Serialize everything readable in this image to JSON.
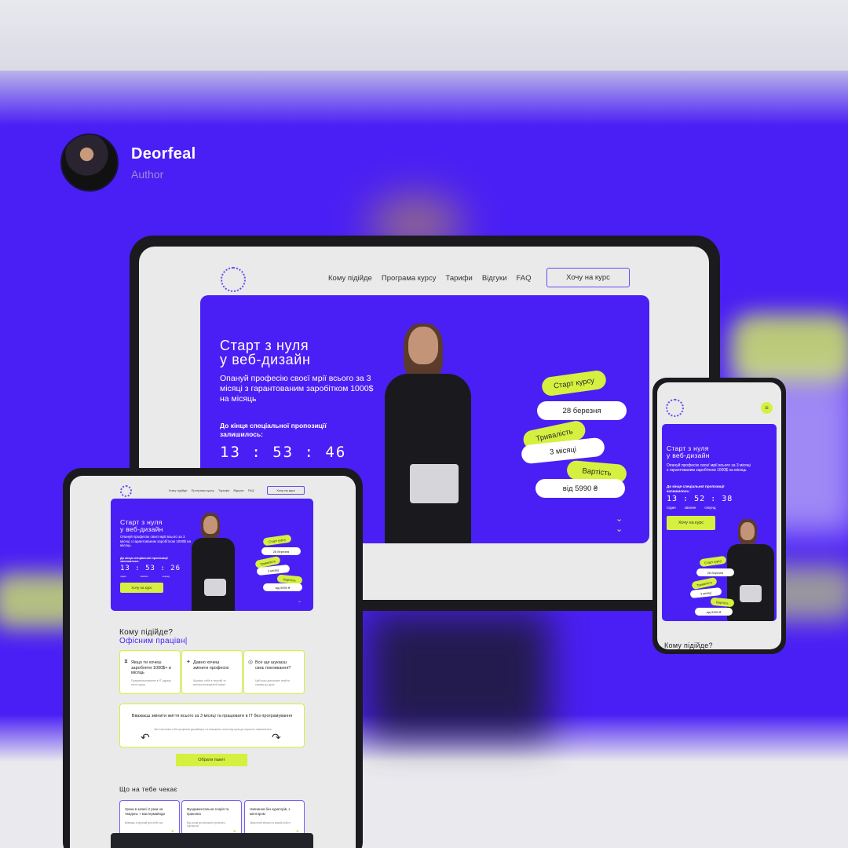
{
  "author": {
    "name": "Deorfeal",
    "role": "Author"
  },
  "nav": {
    "items": [
      "Кому підійде",
      "Програма курсу",
      "Тарифи",
      "Відгуки",
      "FAQ"
    ],
    "cta": "Хочу на курс"
  },
  "hero": {
    "title_line1": "Старт з нуля",
    "title_line2": "у веб-дизайн",
    "subtitle": "Опануй професію своєї мрії всього за 3 місяці з гарантованим заробітком 1000$ на місяць",
    "until": "До кінця спеціальної пропозиції залишилось:",
    "timer_desktop": "13 : 53 : 46",
    "timer_tablet": "13 : 53 : 26",
    "timer_phone": "13 : 52 : 38",
    "units": [
      "годин",
      "хвилин",
      "секунд"
    ],
    "button": "Хочу на курс",
    "start_label": "Старт курсу",
    "start_value": "28 березня",
    "duration_label": "Тривалість",
    "duration_value": "3 місяці",
    "price_label": "Вартість",
    "price_value": "від 5990 ₴",
    "down_icon": "chevron-double-down-icon"
  },
  "tablet": {
    "for_title": "Кому підійде?",
    "for_subtitle": "Офісним працівн|",
    "cards": [
      {
        "title": "Якщо ти хочеш заробляти 1000$+ в місяць",
        "desc": "Працевлаштування в IT одразу після курсу",
        "icon": "hourglass-icon"
      },
      {
        "title": "Давно хочеш змінити професію",
        "desc": "Шукаєш себе в творчій та високооплачуваній сфері",
        "icon": "star-icon"
      },
      {
        "title": "Все ще шукаєш своє покликання?",
        "desc": "Цей курс допоможе знайти справу до душі",
        "icon": "globe-icon"
      }
    ],
    "wide_title": "Вважаєш змінити життя всього за 3 місяці та працювати в IT без програмування",
    "wide_desc": "Ми пояснимо тобі професію дизайнера та покажемо шлях від нуля до першого замовлення",
    "pick_button": "Обрати пакет",
    "waits_title": "Що на тебе чекає",
    "cards2": [
      {
        "title": "Уроки в записі 2 рази на тиждень + мастермайнди",
        "desc": "Вивчаєш в зручний для себе час"
      },
      {
        "title": "Фундаментальна теорія та практика",
        "desc": "Від основ до реальних проєктів у портфоліо"
      },
      {
        "title": "Навчання без кураторів, з ментором",
        "desc": "Зворотний зв'язок по кожній роботі"
      }
    ]
  },
  "phone": {
    "for_title": "Кому підійде?",
    "menu_icon": "hamburger-menu-icon"
  },
  "colors": {
    "accent": "#4a1ff5",
    "lime": "#d6f03f",
    "dark": "#1b1b1f",
    "light": "#eaeaea"
  }
}
